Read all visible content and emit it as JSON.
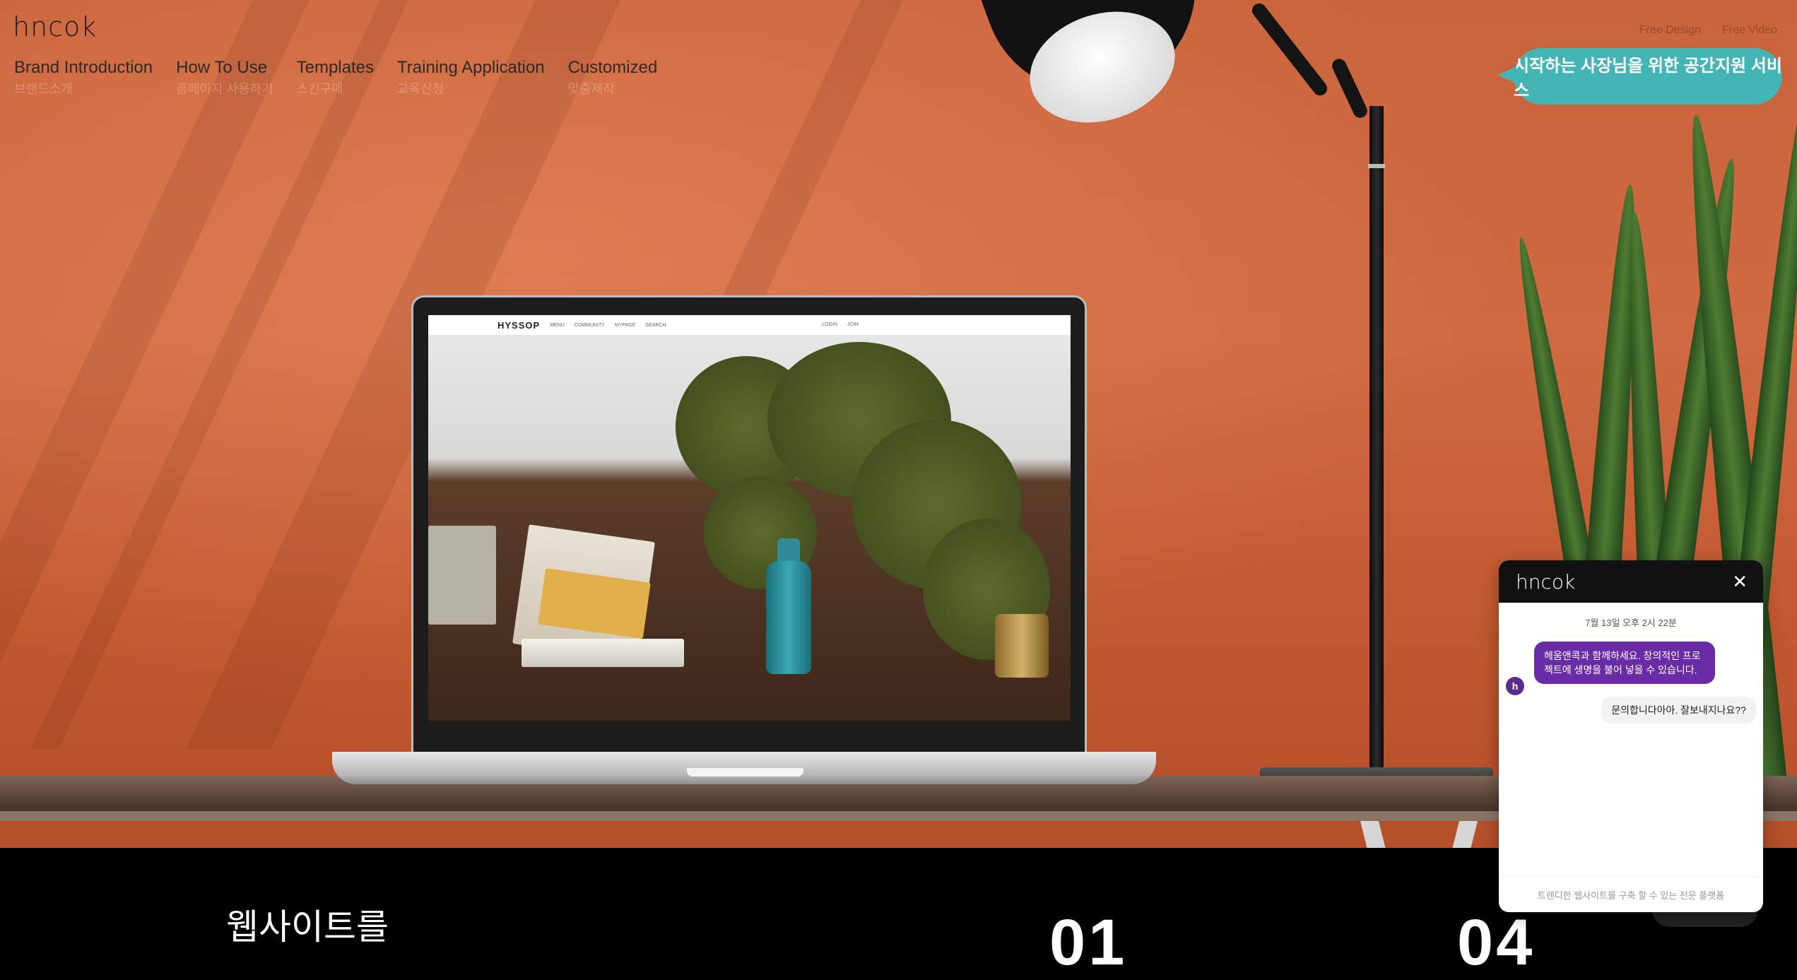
{
  "brand": {
    "logo": "hncok"
  },
  "nav": [
    {
      "label": "Brand Introduction",
      "sub": "브랜드소개"
    },
    {
      "label": "How To Use",
      "sub": "홈페이지 사용하기"
    },
    {
      "label": "Templates",
      "sub": "스킨구매"
    },
    {
      "label": "Training Application",
      "sub": "교육신청"
    },
    {
      "label": "Customized",
      "sub": "맞춤제작"
    }
  ],
  "top_links": [
    "Free Design",
    "Free Video"
  ],
  "promo": {
    "text": "시작하는 사장님을 위한 공간지원 서비스"
  },
  "laptop_site": {
    "brand": "HYSSOP",
    "menu": [
      "MENU",
      "COMMUNITY",
      "MYPAGE",
      "SEARCH"
    ],
    "right_menu": [
      "LOGIN",
      "JOIN"
    ]
  },
  "section": {
    "title": "웹사이트를",
    "num1": "01",
    "num2": "04"
  },
  "chat": {
    "logo": "hncok",
    "close": "✕",
    "avatar": "h",
    "time": "7월 13일 오후 2시 22분",
    "agent_message": "헤움앤콕과 함께하세요. 창의적인 프로젝트에 생명을 불어 넣을 수 있습니다.",
    "user_message": "문의합니다아아. 잘보내지나요??",
    "input_placeholder": "트렌디한 웹사이트를 구축 할 수 있는 전문 플랫폼"
  },
  "colors": {
    "hero_orange": "#c9633c",
    "promo_teal": "#43b5b5",
    "chat_purple": "#6a2ba6"
  }
}
